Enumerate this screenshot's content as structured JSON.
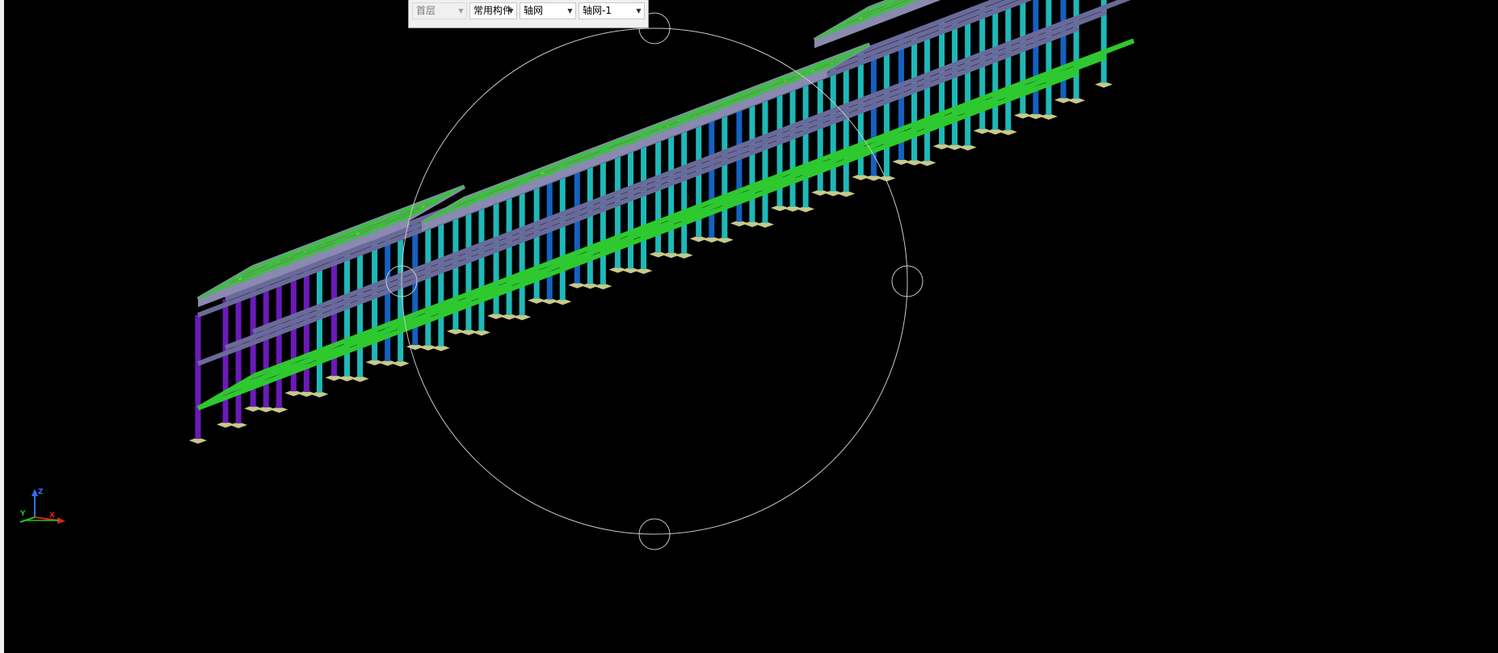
{
  "toolbar": {
    "floor_select": {
      "value": "首层",
      "disabled": true
    },
    "component_type_select": {
      "value": "常用构件"
    },
    "component_select": {
      "value": "轴网"
    },
    "instance_select": {
      "value": "轴网-1"
    }
  },
  "viewport": {
    "background": "#000000",
    "triad": {
      "z_label": "Z",
      "y_label": "Y",
      "x_label": "X"
    },
    "colors": {
      "slab": "#8a8ab0",
      "slab_edge": "#6a6a9a",
      "beam_green": "#2ec92e",
      "column_cyan": "#1fb8b8",
      "column_blue": "#1560c0",
      "column_purple": "#6a1ab8",
      "footing": "#c8c88a",
      "rebar_yellow": "#d8c040",
      "orbit_circle": "#c8c8c8"
    }
  }
}
